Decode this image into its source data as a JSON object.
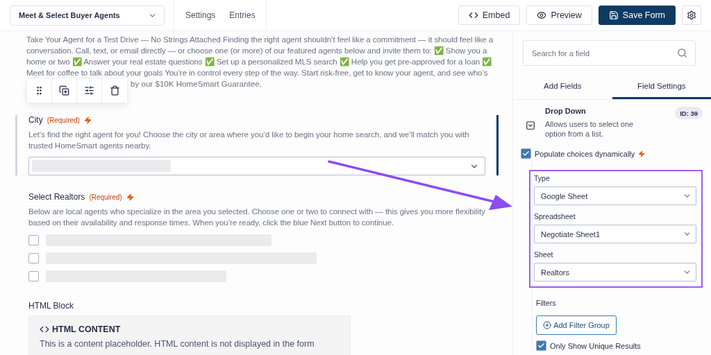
{
  "form_selector": {
    "value": "Meet & Select Buyer Agents"
  },
  "nav_links": [
    {
      "label": "Settings"
    },
    {
      "label": "Entries"
    }
  ],
  "actions": [
    {
      "kind": "embed",
      "label": "Embed"
    },
    {
      "kind": "preview",
      "label": "Preview"
    },
    {
      "kind": "save",
      "label": "Save Form"
    }
  ],
  "intro": {
    "lines": [
      "Take Your Agent for a Test Drive — No Strings Attached Finding the right agent shouldn’t feel like a commitment — it should feel like a",
      "conversation. Call, text, or email directly — or choose one (or more) of our featured agents below and invite them to: ✅ Show you a",
      "home or two ✅ Answer your real estate questions ✅ Set up a personalized MLS search ✅ Help you get pre-approved for a loan ✅",
      "Meet for coffee to talk about your goals You’re in control every step of the way. Start risk-free, get to know your agent, and see who’s"
    ],
    "continuation": "by our $10K HomeSmart Guarantee."
  },
  "fields": [
    {
      "kind": "dropdown",
      "label": "City",
      "required": "(Required)",
      "selected": true,
      "description": "Let’s find the right agent for you! Choose the city or area where you’d like to begin your home search, and we’ll match you with trusted HomeSmart agents nearby."
    },
    {
      "kind": "checkboxes",
      "label": "Select Realtors",
      "required": "(Required)",
      "selected": false,
      "description": "Below are local agents who specialize in the area you selected. Choose one or two to connect with — this gives you more flexibility based on their availability and response times. When you’re ready, click the blue Next button to continue.",
      "options": [
        {
          "checked": false
        },
        {
          "checked": false
        },
        {
          "checked": false
        }
      ]
    },
    {
      "kind": "html",
      "label": "HTML Block",
      "selected": false,
      "heading": "HTML CONTENT",
      "body": "This is a content placeholder. HTML content is not displayed in the form"
    }
  ],
  "sidebar": {
    "search": {
      "placeholder": "Search for a field"
    },
    "tabs": [
      {
        "label": "Add Fields",
        "selected": false
      },
      {
        "label": "Field Settings",
        "selected": true
      }
    ],
    "field_info": {
      "name": "Drop Down",
      "description": "Allows users to select one option from a list.",
      "id_badge": "ID: 39"
    },
    "populate": {
      "label": "Populate choices dynamically",
      "checked": true
    },
    "source": [
      {
        "label": "Type",
        "value": "Google Sheet"
      },
      {
        "label": "Spreadsheet",
        "value": "Negotiate Sheet1"
      },
      {
        "label": "Sheet",
        "value": "Realtors"
      }
    ],
    "filters": {
      "label": "Filters",
      "button": "Add Filter Group"
    },
    "unique": {
      "label": "Only Show Unique Results",
      "checked": true
    }
  }
}
